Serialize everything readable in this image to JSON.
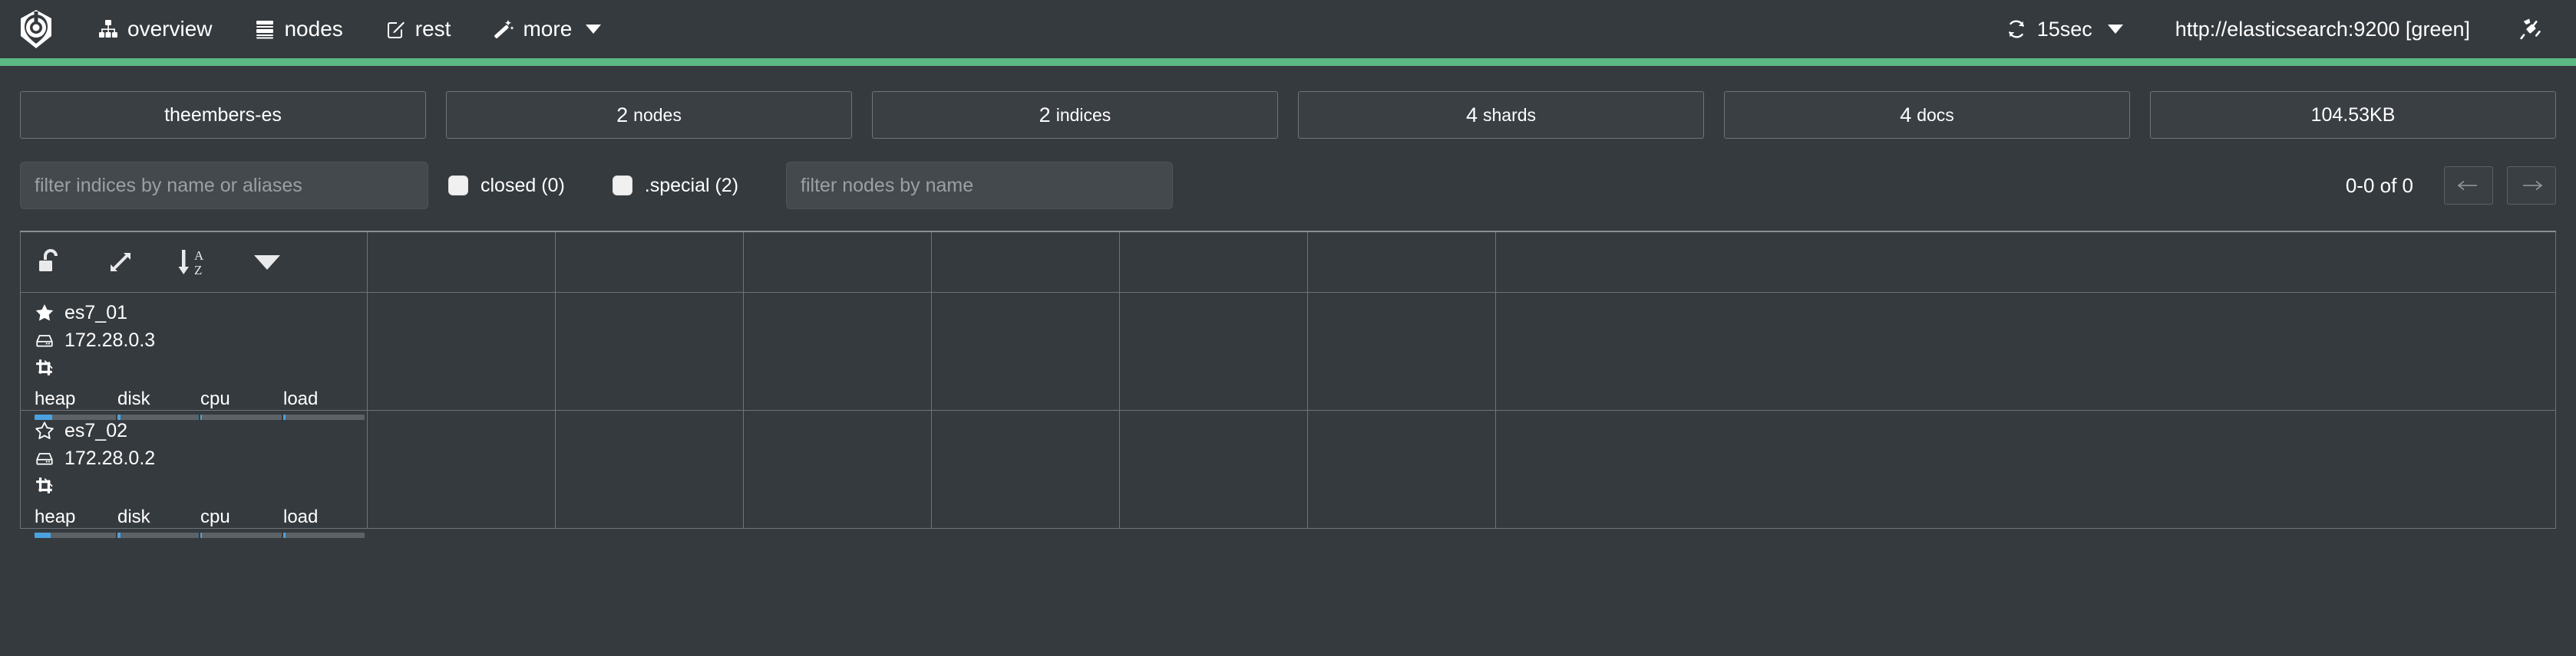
{
  "header": {
    "logo_icon": "cerebro-logo-icon",
    "nav_items": [
      {
        "label": "overview",
        "icon": "sitemap-icon"
      },
      {
        "label": "nodes",
        "icon": "server-stack-icon"
      },
      {
        "label": "rest",
        "icon": "edit-square-icon"
      },
      {
        "label": "more",
        "icon": "magic-wand-icon",
        "has_caret": true
      }
    ],
    "refresh": {
      "label": "15sec",
      "icon": "refresh-icon",
      "has_caret": true
    },
    "cluster_url": "http://elasticsearch:9200 [green]",
    "disconnect_icon": "plug-icon",
    "health_color": "#5cb884"
  },
  "stats": [
    {
      "name": "cluster-name",
      "value": "theembers-es",
      "unit": ""
    },
    {
      "name": "nodes-count",
      "value": "2",
      "unit": "nodes"
    },
    {
      "name": "indices-count",
      "value": "2",
      "unit": "indices"
    },
    {
      "name": "shards-count",
      "value": "4",
      "unit": "shards"
    },
    {
      "name": "docs-count",
      "value": "4",
      "unit": "docs"
    },
    {
      "name": "store-size",
      "value": "104.53KB",
      "unit": ""
    }
  ],
  "filters": {
    "indices_placeholder": "filter indices by name or aliases",
    "indices_value": "",
    "nodes_placeholder": "filter nodes by name",
    "nodes_value": "",
    "checkboxes": [
      {
        "label": "closed (0)",
        "checked": false
      },
      {
        "label": ".special (2)",
        "checked": false
      }
    ],
    "pager": {
      "range_label": "0-0 of 0",
      "prev_icon": "arrow-left-icon",
      "next_icon": "arrow-right-icon"
    }
  },
  "table": {
    "toolbar": [
      {
        "name": "unlock-icon",
        "label": "unlock"
      },
      {
        "name": "expand-arrows-icon",
        "label": "expand"
      },
      {
        "name": "sort-alpha-asc-icon",
        "label": "sort a-z"
      },
      {
        "name": "chevron-down-icon",
        "label": "more"
      }
    ],
    "nodes": [
      {
        "name": "es7_01",
        "ip": "172.28.0.3",
        "master": true,
        "star_icon": "star-filled-icon",
        "host_icon": "server-icon",
        "role_icon": "data-node-icon",
        "meters": [
          {
            "label": "heap",
            "percent": 22
          },
          {
            "label": "disk",
            "percent": 4
          },
          {
            "label": "cpu",
            "percent": 2
          },
          {
            "label": "load",
            "percent": 3
          }
        ]
      },
      {
        "name": "es7_02",
        "ip": "172.28.0.2",
        "master": false,
        "star_icon": "star-outline-icon",
        "host_icon": "server-icon",
        "role_icon": "data-node-icon",
        "meters": [
          {
            "label": "heap",
            "percent": 20
          },
          {
            "label": "disk",
            "percent": 4
          },
          {
            "label": "cpu",
            "percent": 2
          },
          {
            "label": "load",
            "percent": 3
          }
        ]
      }
    ],
    "empty_columns": 7
  },
  "colors": {
    "background": "#353a3e",
    "panel": "#3a3f44",
    "border": "#6d7378",
    "accent_green": "#5cb884",
    "meter_blue": "#4aa3e0",
    "text": "#ffffff"
  }
}
